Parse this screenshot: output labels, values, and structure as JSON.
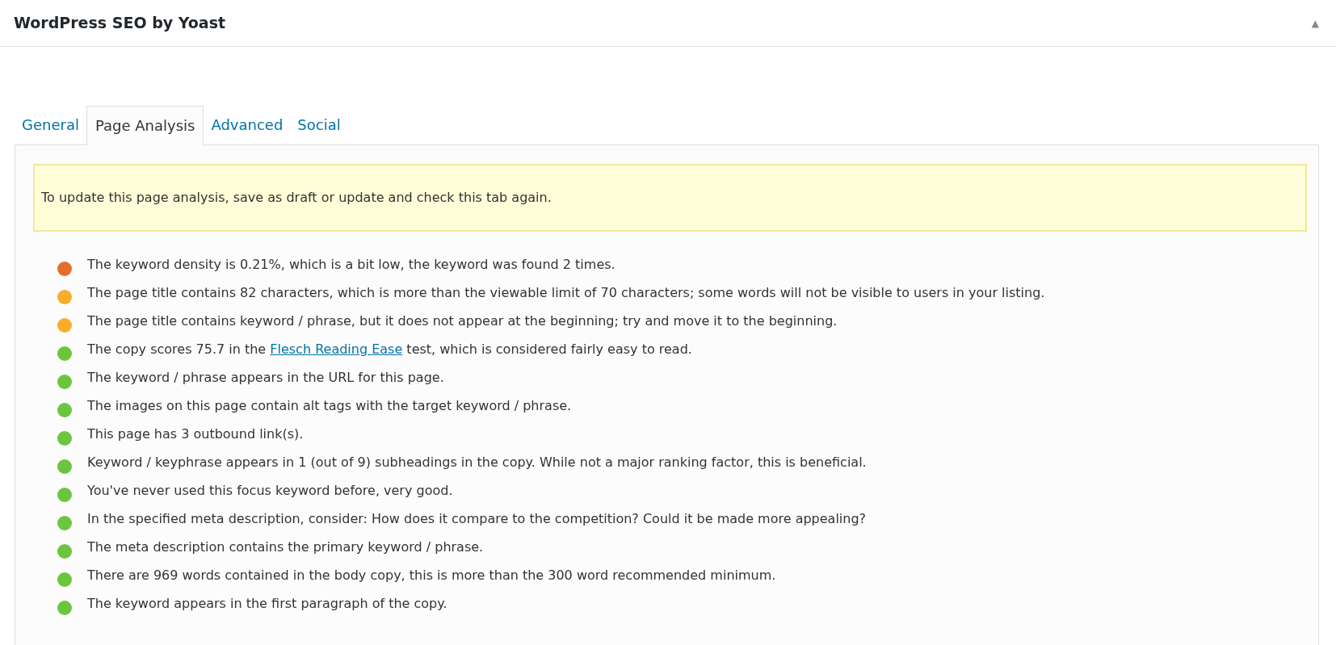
{
  "panel": {
    "title": "WordPress SEO by Yoast",
    "collapse": "▲"
  },
  "tabs": [
    {
      "label": "General",
      "selected": false
    },
    {
      "label": "Page Analysis",
      "selected": true
    },
    {
      "label": "Advanced",
      "selected": false
    },
    {
      "label": "Social",
      "selected": false
    }
  ],
  "notice": "To update this page analysis, save as draft or update and check this tab again.",
  "results": [
    {
      "color": "#e2702c",
      "segments": [
        {
          "kind": "plain",
          "text": "The keyword density is 0.21%, which is a bit low, the keyword was found 2 times."
        }
      ]
    },
    {
      "color": "#f9ad2a",
      "segments": [
        {
          "kind": "plain",
          "text": "The page title contains 82 characters, which is more than the viewable limit of 70 characters; some words will not be visible to users in your listing."
        }
      ]
    },
    {
      "color": "#f9ad2a",
      "segments": [
        {
          "kind": "plain",
          "text": "The page title contains keyword / phrase, but it does not appear at the beginning; try and move it to the beginning."
        }
      ]
    },
    {
      "color": "#6bc63e",
      "segments": [
        {
          "kind": "plain",
          "text": "The copy scores 75.7 in the "
        },
        {
          "kind": "link",
          "text": "Flesch Reading Ease"
        },
        {
          "kind": "plain",
          "text": " test, which is considered fairly easy to read."
        }
      ]
    },
    {
      "color": "#6bc63e",
      "segments": [
        {
          "kind": "plain",
          "text": "The keyword / phrase appears in the URL for this page."
        }
      ]
    },
    {
      "color": "#6bc63e",
      "segments": [
        {
          "kind": "plain",
          "text": "The images on this page contain alt tags with the target keyword / phrase."
        }
      ]
    },
    {
      "color": "#6bc63e",
      "segments": [
        {
          "kind": "plain",
          "text": "This page has 3 outbound link(s)."
        }
      ]
    },
    {
      "color": "#6bc63e",
      "segments": [
        {
          "kind": "plain",
          "text": "Keyword / keyphrase appears in 1 (out of 9) subheadings in the copy. While not a major ranking factor, this is beneficial."
        }
      ]
    },
    {
      "color": "#6bc63e",
      "segments": [
        {
          "kind": "plain",
          "text": "You've never used this focus keyword before, very good."
        }
      ]
    },
    {
      "color": "#6bc63e",
      "segments": [
        {
          "kind": "plain",
          "text": "In the specified meta description, consider: How does it compare to the competition? Could it be made more appealing?"
        }
      ]
    },
    {
      "color": "#6bc63e",
      "segments": [
        {
          "kind": "plain",
          "text": "The meta description contains the primary keyword / phrase."
        }
      ]
    },
    {
      "color": "#6bc63e",
      "segments": [
        {
          "kind": "plain",
          "text": "There are 969 words contained in the body copy, this is more than the 300 word recommended minimum."
        }
      ]
    },
    {
      "color": "#6bc63e",
      "segments": [
        {
          "kind": "plain",
          "text": "The keyword appears in the first paragraph of the copy."
        }
      ]
    }
  ]
}
